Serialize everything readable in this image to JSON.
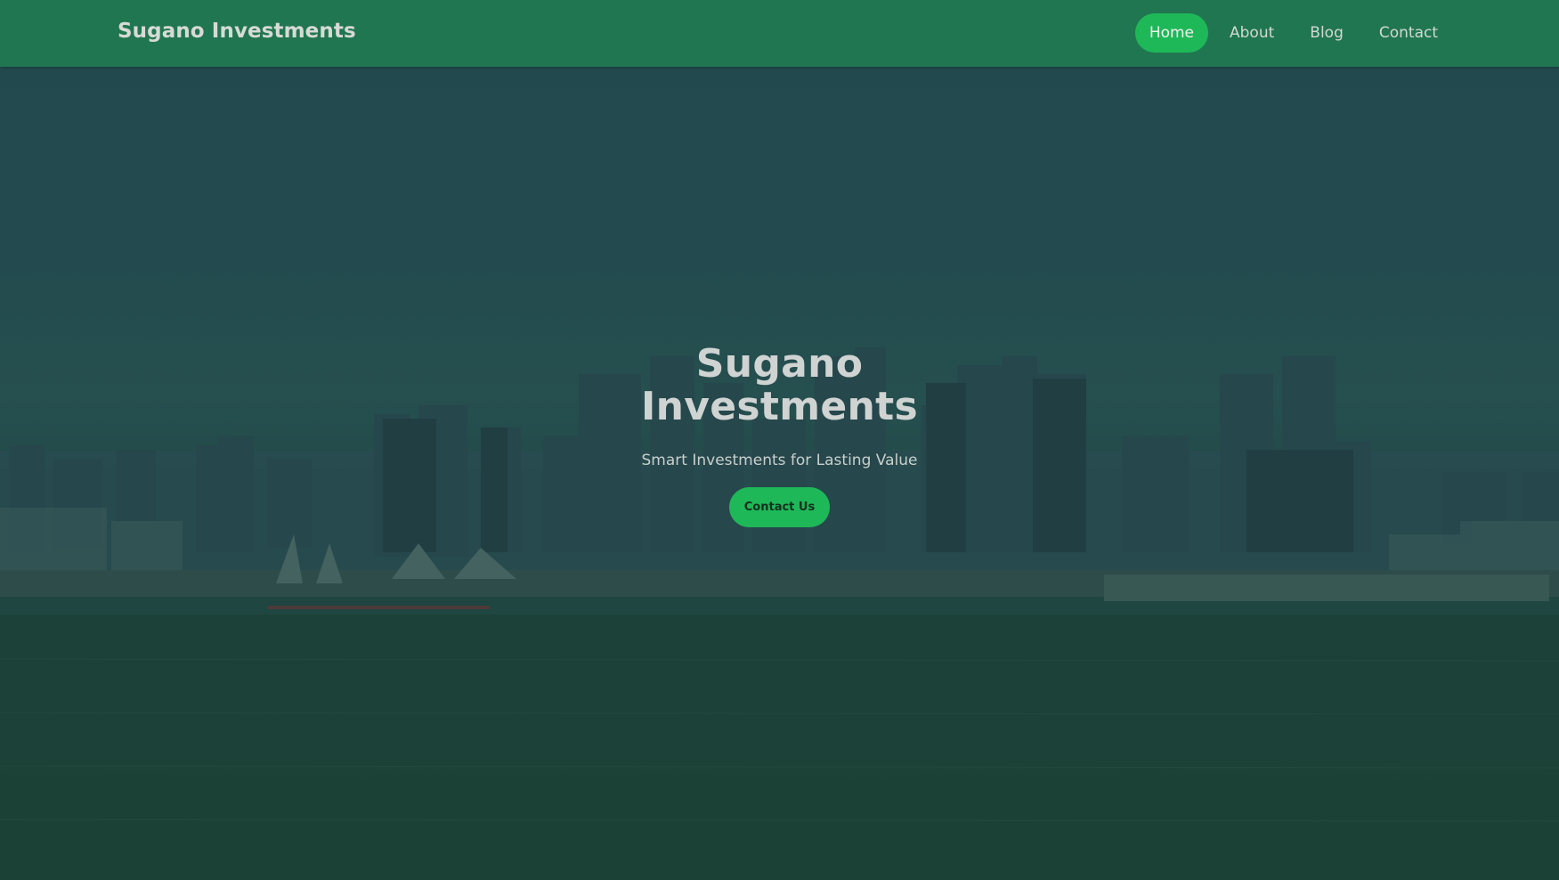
{
  "navbar": {
    "brand": "Sugano Investments",
    "links": [
      {
        "label": "Home",
        "active": true
      },
      {
        "label": "About",
        "active": false
      },
      {
        "label": "Blog",
        "active": false
      },
      {
        "label": "Contact",
        "active": false
      }
    ]
  },
  "hero": {
    "title": "Sugano Investments",
    "subtitle": "Smart Investments for Lasting Value",
    "cta_label": "Contact Us",
    "background": "city-skyline-harbor-photo"
  },
  "colors": {
    "navbar_bg": "#207650",
    "accent": "#1fb858",
    "overlay": "#1f4a49"
  }
}
